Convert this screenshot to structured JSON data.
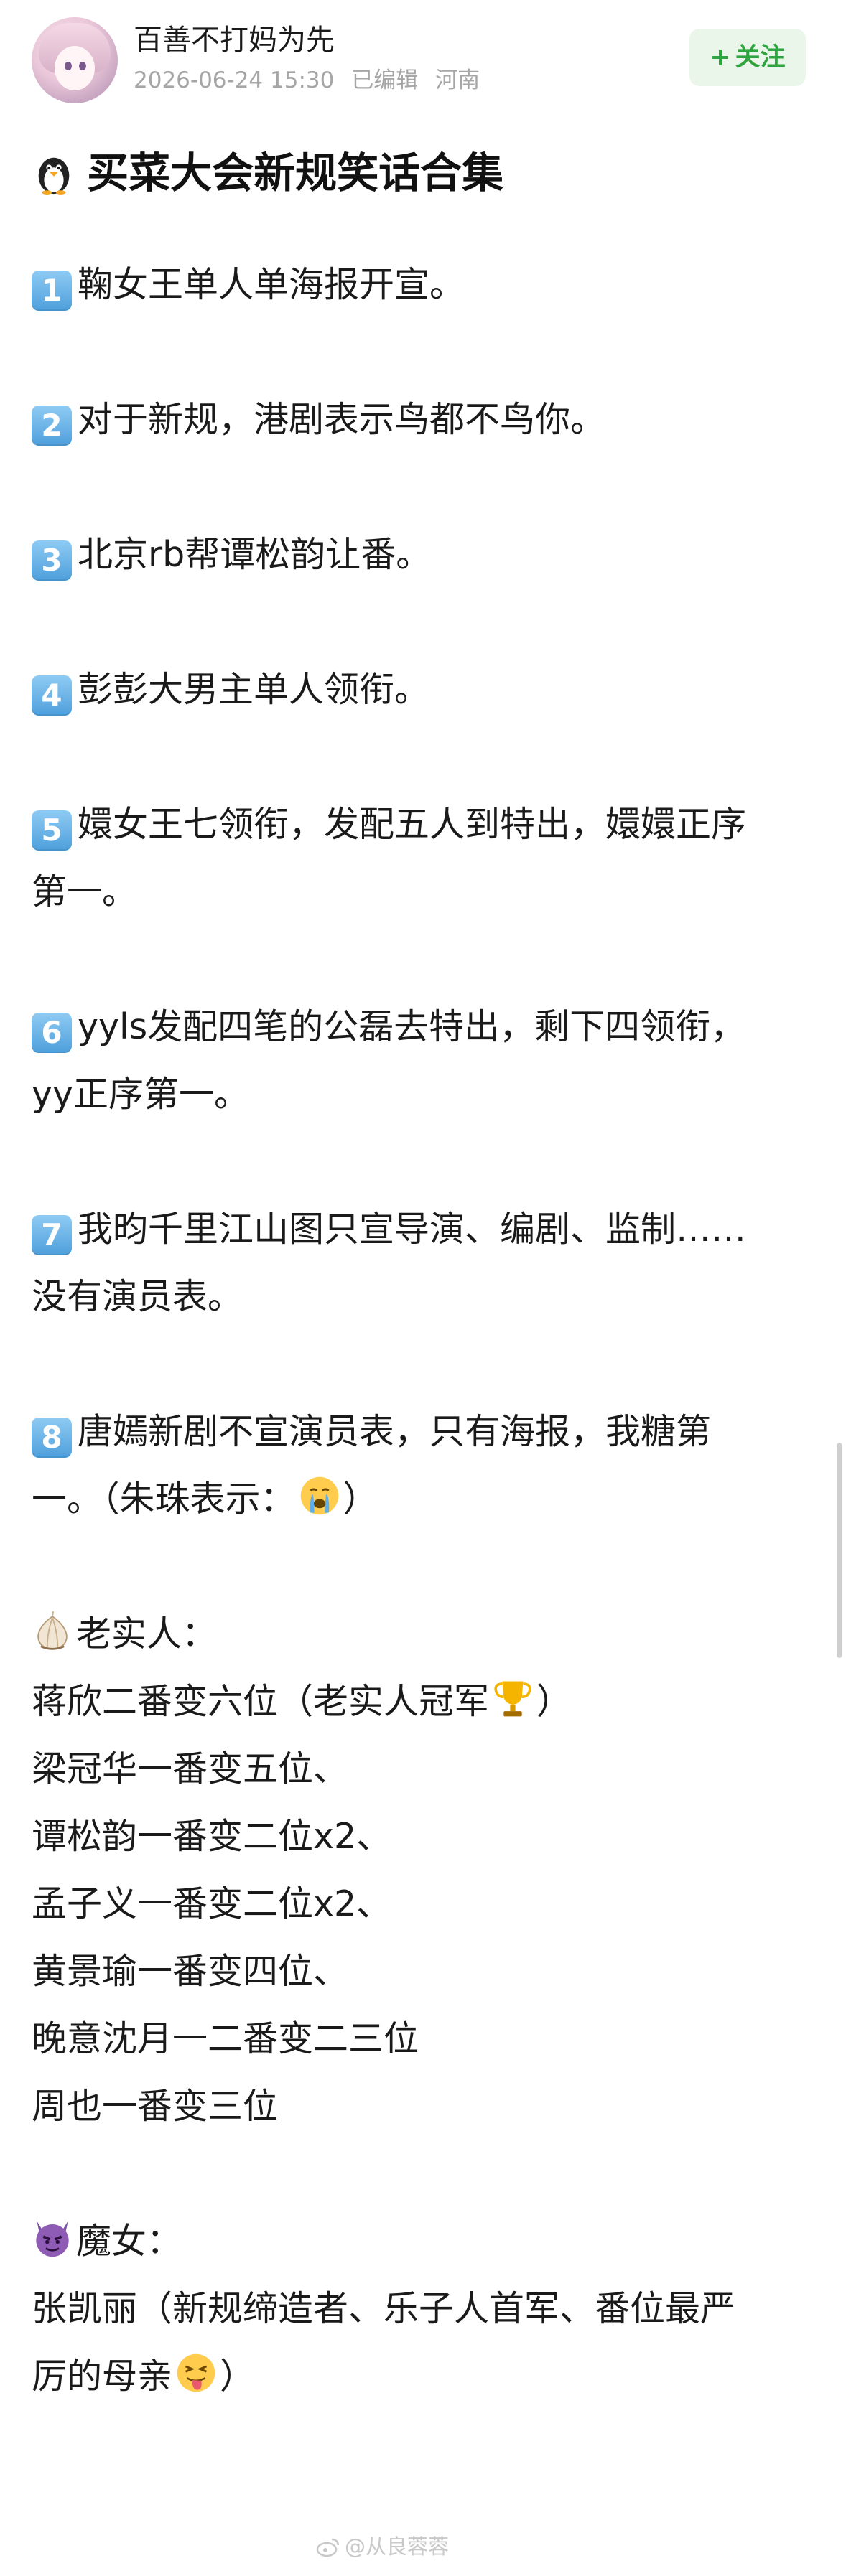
{
  "header": {
    "username": "百善不打妈为先",
    "date": "2026-06-24 15:30",
    "edited": "已编辑",
    "location": "河南",
    "follow_plus": "+",
    "follow_label": "关注"
  },
  "post": {
    "title": "买菜大会新规笑话合集",
    "title_icon": "penguin-emoji",
    "items": [
      {
        "num": "1",
        "text": "鞠女王单人单海报开宣。"
      },
      {
        "num": "2",
        "text": "对于新规，港剧表示鸟都不鸟你。"
      },
      {
        "num": "3",
        "text": "北京rb帮谭松韵让番。"
      },
      {
        "num": "4",
        "text": "彭彭大男主单人领衔。"
      },
      {
        "num": "5",
        "line1": "嬛女王七领衔，发配五人到特出，嬛嬛正序",
        "line2": "第一。"
      },
      {
        "num": "6",
        "line1": "yyls发配四笔的公磊去特出，剩下四领衔，",
        "line2": "yy正序第一。"
      },
      {
        "num": "7",
        "line1": "我昀千里江山图只宣导演、编剧、监制……",
        "line2": "没有演员表。"
      },
      {
        "num": "8",
        "line1": "唐嫣新剧不宣演员表，只有海报，我糖第",
        "line2_a": "一。（朱珠表示：",
        "line2_b": "）",
        "emoji": "crying-face"
      }
    ],
    "honest": {
      "icon": "garlic-emoji",
      "heading": "老实人：",
      "lines": [
        {
          "text": "蒋欣二番变六位（老实人冠军",
          "tail": "）",
          "emoji": "trophy"
        },
        {
          "text": "梁冠华一番变五位、"
        },
        {
          "text": "谭松韵一番变二位x2、"
        },
        {
          "text": "孟子义一番变二位x2、"
        },
        {
          "text": "黄景瑜一番变四位、"
        },
        {
          "text": "晚意沈月一二番变二三位"
        },
        {
          "text": "周也一番变三位"
        }
      ]
    },
    "witch": {
      "icon": "purple-devil-emoji",
      "heading": "魔女：",
      "line1": "张凯丽（新规缔造者、乐子人首军、番位最严",
      "line2_a": "厉的母亲",
      "line2_b": "）",
      "emoji": "tongue-out-face"
    }
  },
  "watermark": "@从良蓉蓉"
}
